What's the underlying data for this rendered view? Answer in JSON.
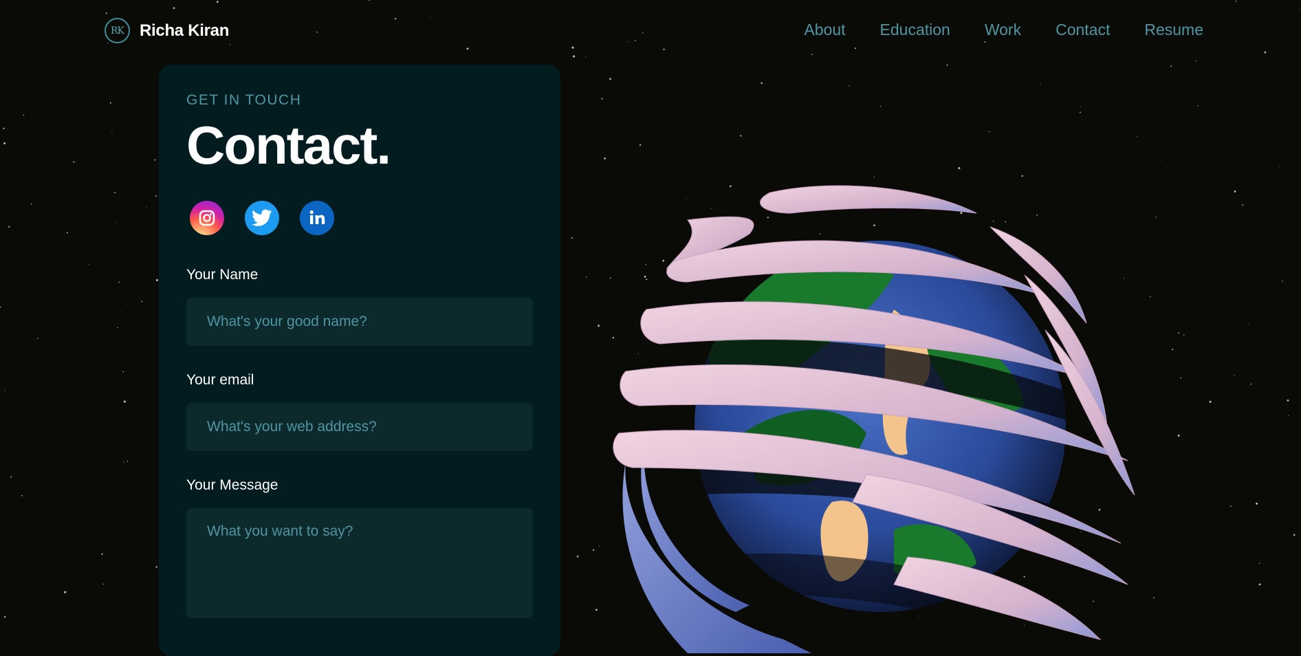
{
  "header": {
    "logo_initials": "RK",
    "logo_name": "Richa Kiran",
    "nav": [
      "About",
      "Education",
      "Work",
      "Contact",
      "Resume"
    ]
  },
  "contact": {
    "eyebrow": "GET IN TOUCH",
    "title": "Contact.",
    "socials": [
      "instagram-icon",
      "twitter-icon",
      "linkedin-icon"
    ],
    "fields": {
      "name_label": "Your Name",
      "name_placeholder": "What's your good name?",
      "email_label": "Your email",
      "email_placeholder": "What's your web address?",
      "message_label": "Your Message",
      "message_placeholder": "What you want to say?"
    }
  },
  "colors": {
    "background": "#0a0b07",
    "card": "#031c1f",
    "field": "#0c2a2b",
    "accent": "#4f95a3"
  }
}
